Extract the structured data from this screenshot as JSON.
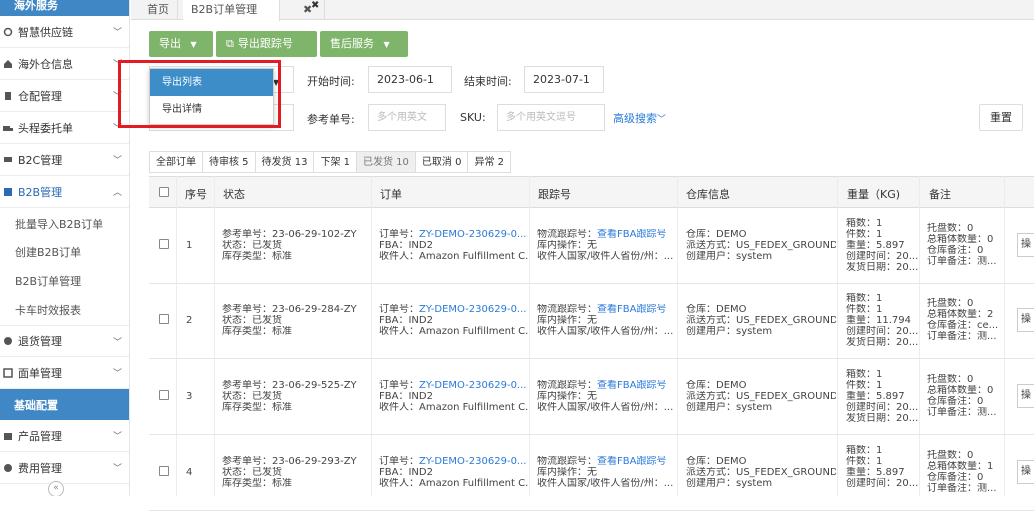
{
  "sidebar": {
    "header": "海外服务",
    "items": [
      {
        "label": "智慧供应链"
      },
      {
        "label": "海外仓信息"
      },
      {
        "label": "仓配管理"
      },
      {
        "label": "头程委托单"
      },
      {
        "label": "B2C管理"
      },
      {
        "label": "B2B管理"
      }
    ],
    "sub_items": [
      {
        "label": "批量导入B2B订单"
      },
      {
        "label": "创建B2B订单"
      },
      {
        "label": "B2B订单管理"
      },
      {
        "label": "卡车时效报表"
      }
    ],
    "after_items": [
      {
        "label": "退货管理"
      },
      {
        "label": "面单管理"
      }
    ],
    "section2": "基础配置",
    "items2": [
      {
        "label": "产品管理"
      },
      {
        "label": "费用管理"
      }
    ],
    "collapse": "«"
  },
  "tabs": {
    "home": "首页",
    "b2b": "B2B订单管理",
    "close": "✖"
  },
  "toolbar": {
    "export": "导出",
    "export_tracking": "导出跟踪号",
    "after_sales": "售后服务"
  },
  "dropdown": {
    "items": [
      "导出列表",
      "导出详情"
    ]
  },
  "filters": {
    "start_label": "开始时间:",
    "start_value": "2023-06-1",
    "end_label": "结束时间:",
    "end_value": "2023-07-1",
    "ref_label": "参考单号:",
    "ref_placeholder": "多个用英文",
    "sku_label": "SKU:",
    "sku_placeholder": "多个用英文逗号",
    "advanced": "高级搜索",
    "reset": "重置"
  },
  "status_tabs": [
    {
      "label": "全部订单"
    },
    {
      "label": "待审核 5"
    },
    {
      "label": "待发货 13"
    },
    {
      "label": "下架 1"
    },
    {
      "label": "已发货 10"
    },
    {
      "label": "已取消 0"
    },
    {
      "label": "异常 2"
    }
  ],
  "table": {
    "headers": {
      "no": "序号",
      "status": "状态",
      "order": "订单",
      "tracking": "跟踪号",
      "warehouse": "仓库信息",
      "weight": "重量（KG)",
      "remark": "备注"
    },
    "rows": [
      {
        "no": "1",
        "status": [
          "参考单号：23-06-29-102-ZY",
          "状态：已发货",
          "库存类型：标准"
        ],
        "order_label": "订单号：",
        "order_link": "ZY-DEMO-230629-0...",
        "order_lines": [
          "FBA：IND2",
          "收件人：Amazon Fulfillment C..."
        ],
        "track_label": "物流跟踪号：",
        "track_link": "查看FBA跟踪号",
        "track_lines": [
          "库内操作：无",
          "收件人国家/收件人省份/州：..."
        ],
        "wh": [
          "仓库：DEMO",
          "派送方式：US_FEDEX_GROUND",
          "创建用户：system"
        ],
        "weight": [
          "箱数：1",
          "件数：1",
          "重量：5.897",
          "创建时间：20...",
          "发货日期：20..."
        ],
        "remark": [
          "托盘数：0",
          "总箱体数量：0",
          "仓库备注：0",
          "订单备注：测..."
        ]
      },
      {
        "no": "2",
        "status": [
          "参考单号：23-06-29-284-ZY",
          "状态：已发货",
          "库存类型：标准"
        ],
        "order_label": "订单号：",
        "order_link": "ZY-DEMO-230629-0...",
        "order_lines": [
          "FBA：IND2",
          "收件人：Amazon Fulfillment C..."
        ],
        "track_label": "物流跟踪号：",
        "track_link": "查看FBA跟踪号",
        "track_lines": [
          "库内操作：无",
          "收件人国家/收件人省份/州：..."
        ],
        "wh": [
          "仓库：DEMO",
          "派送方式：US_FEDEX_GROUND",
          "创建用户：system"
        ],
        "weight": [
          "箱数：1",
          "件数：1",
          "重量：11.794",
          "创建时间：20...",
          "发货日期：20..."
        ],
        "remark": [
          "托盘数：0",
          "总箱体数量：2",
          "仓库备注：ce...",
          "订单备注：测..."
        ]
      },
      {
        "no": "3",
        "status": [
          "参考单号：23-06-29-525-ZY",
          "状态：已发货",
          "库存类型：标准"
        ],
        "order_label": "订单号：",
        "order_link": "ZY-DEMO-230629-0...",
        "order_lines": [
          "FBA：IND2",
          "收件人：Amazon Fulfillment C..."
        ],
        "track_label": "物流跟踪号：",
        "track_link": "查看FBA跟踪号",
        "track_lines": [
          "库内操作：无",
          "收件人国家/收件人省份/州：..."
        ],
        "wh": [
          "仓库：DEMO",
          "派送方式：US_FEDEX_GROUND",
          "创建用户：system"
        ],
        "weight": [
          "箱数：1",
          "件数：1",
          "重量：5.897",
          "创建时间：20...",
          "发货日期：20..."
        ],
        "remark": [
          "托盘数：0",
          "总箱体数量：0",
          "仓库备注：0",
          "订单备注：测..."
        ]
      },
      {
        "no": "4",
        "status": [
          "参考单号：23-06-29-293-ZY",
          "状态：已发货",
          "库存类型：标准"
        ],
        "order_label": "订单号：",
        "order_link": "ZY-DEMO-230629-0...",
        "order_lines": [
          "FBA：IND2",
          "收件人：Amazon Fulfillment C..."
        ],
        "track_label": "物流跟踪号：",
        "track_link": "查看FBA跟踪号",
        "track_lines": [
          "库内操作：无",
          "收件人国家/收件人省份/州：..."
        ],
        "wh": [
          "仓库：DEMO",
          "派送方式：US_FEDEX_GROUND",
          "创建用户：system"
        ],
        "weight": [
          "箱数：1",
          "件数：1",
          "重量：5.897",
          "创建时间：20..."
        ],
        "remark": [
          "托盘数：0",
          "总箱体数量：1",
          "仓库备注：0",
          "订单备注：测..."
        ]
      }
    ],
    "action": "操"
  },
  "colors": {
    "accent_green": "#7fb56a",
    "sidebar_blue": "#3f88c5",
    "link": "#2a7ad8",
    "highlight": "#e31b23"
  }
}
